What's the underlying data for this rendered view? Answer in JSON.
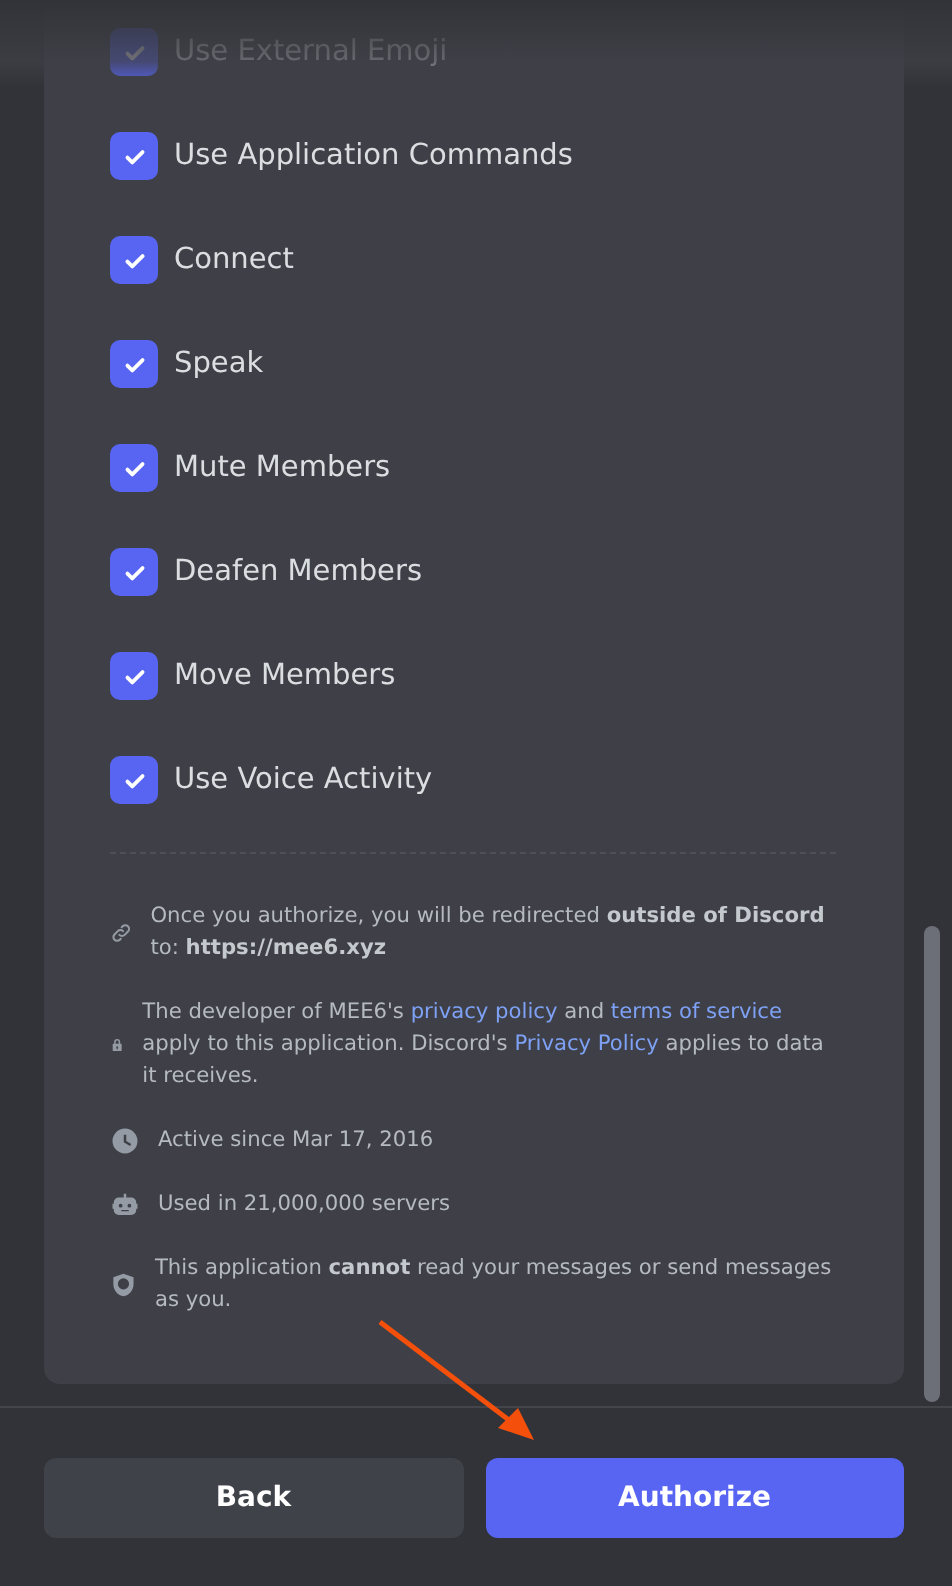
{
  "permissions": [
    {
      "label": "Use External Emoji",
      "checked": true
    },
    {
      "label": "Use Application Commands",
      "checked": true
    },
    {
      "label": "Connect",
      "checked": true
    },
    {
      "label": "Speak",
      "checked": true
    },
    {
      "label": "Mute Members",
      "checked": true
    },
    {
      "label": "Deafen Members",
      "checked": true
    },
    {
      "label": "Move Members",
      "checked": true
    },
    {
      "label": "Use Voice Activity",
      "checked": true
    }
  ],
  "info": [
    {
      "kind": "link",
      "segments": [
        {
          "kind": "plain",
          "text": "Once you authorize, you will be redirected "
        },
        {
          "kind": "bold",
          "text": "outside of Discord"
        },
        {
          "kind": "plain",
          "text": " to: "
        },
        {
          "kind": "bold",
          "text": "https://mee6.xyz"
        }
      ]
    },
    {
      "kind": "lock",
      "segments": [
        {
          "kind": "plain",
          "text": "The developer of MEE6's "
        },
        {
          "kind": "link",
          "text": "privacy policy"
        },
        {
          "kind": "plain",
          "text": " and "
        },
        {
          "kind": "link",
          "text": "terms of service"
        },
        {
          "kind": "plain",
          "text": " apply to this application. Discord's "
        },
        {
          "kind": "link",
          "text": "Privacy Policy"
        },
        {
          "kind": "plain",
          "text": " applies to data it receives."
        }
      ]
    },
    {
      "kind": "clock",
      "segments": [
        {
          "kind": "plain",
          "text": "Active since Mar 17, 2016"
        }
      ]
    },
    {
      "kind": "bot",
      "segments": [
        {
          "kind": "plain",
          "text": "Used in 21,000,000 servers"
        }
      ]
    },
    {
      "kind": "shield",
      "segments": [
        {
          "kind": "plain",
          "text": "This application "
        },
        {
          "kind": "bold",
          "text": "cannot"
        },
        {
          "kind": "plain",
          "text": " read your messages or send messages as you."
        }
      ]
    }
  ],
  "buttons": [
    {
      "label": "Back",
      "kind": "secondary"
    },
    {
      "label": "Authorize",
      "kind": "primary"
    }
  ]
}
